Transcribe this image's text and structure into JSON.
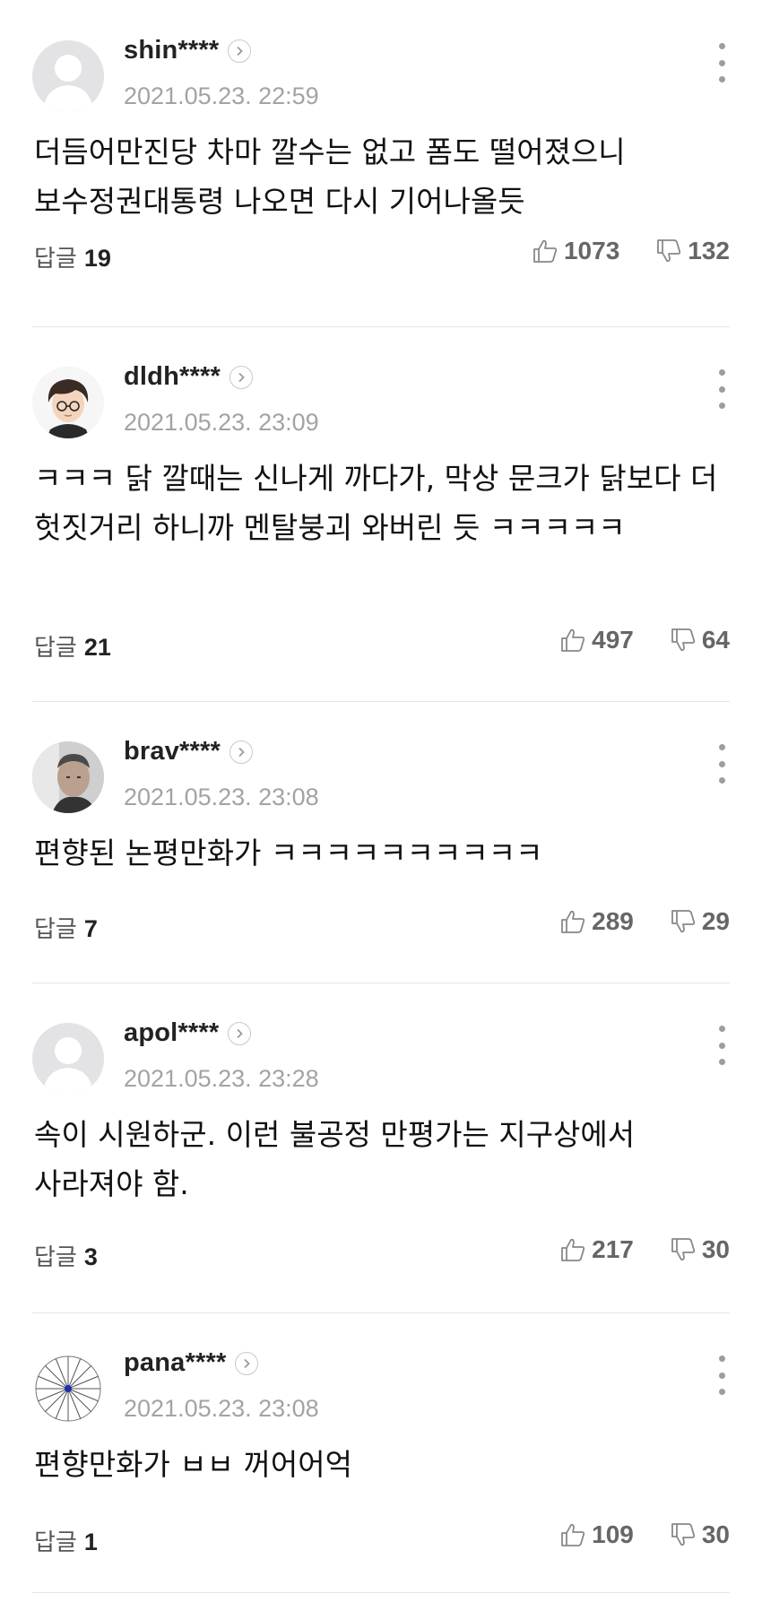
{
  "comments": [
    {
      "username": "shin****",
      "timestamp": "2021.05.23. 22:59",
      "body": "더듬어만진당 차마 깔수는 없고 폼도 떨어졌으니 보수정권대통령 나오면 다시 기어나올듯",
      "reply_label": "답글",
      "reply_count": "19",
      "likes": "1073",
      "dislikes": "132",
      "avatar_icon": "default-user-icon"
    },
    {
      "username": "dldh****",
      "timestamp": "2021.05.23. 23:09",
      "body": "ㅋㅋㅋ 닭 깔때는 신나게 까다가, 막상 문크가 닭보다 더 헛짓거리 하니까 멘탈붕괴 와버린 듯 ㅋㅋㅋㅋㅋ",
      "reply_label": "답글",
      "reply_count": "21",
      "likes": "497",
      "dislikes": "64",
      "avatar_icon": "cartoon-boy-icon"
    },
    {
      "username": "brav****",
      "timestamp": "2021.05.23. 23:08",
      "body": "편향된 논평만화가 ㅋㅋㅋㅋㅋㅋㅋㅋㅋㅋ",
      "reply_label": "답글",
      "reply_count": "7",
      "likes": "289",
      "dislikes": "29",
      "avatar_icon": "photo-portrait-icon"
    },
    {
      "username": "apol****",
      "timestamp": "2021.05.23. 23:28",
      "body": "속이 시원하군. 이런 불공정 만평가는 지구상에서 사라져야 함.",
      "reply_label": "답글",
      "reply_count": "3",
      "likes": "217",
      "dislikes": "30",
      "avatar_icon": "default-user-icon"
    },
    {
      "username": "pana****",
      "timestamp": "2021.05.23. 23:08",
      "body": "편향만화가 ㅂㅂ 꺼어어억",
      "reply_label": "답글",
      "reply_count": "1",
      "likes": "109",
      "dislikes": "30",
      "avatar_icon": "radial-star-icon"
    }
  ],
  "colors": {
    "username": "#222222",
    "timestamp": "#a3a3a3",
    "body": "#111111",
    "vote_count": "#666666",
    "divider": "#e6e6e6"
  }
}
